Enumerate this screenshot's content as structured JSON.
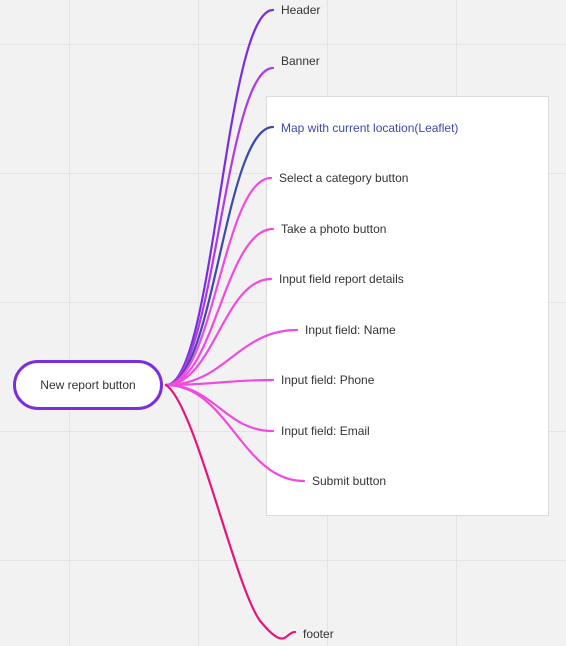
{
  "diagram": {
    "root": {
      "label": "New report button",
      "color": "#7b2ee0"
    },
    "children": [
      {
        "label": "Header",
        "color": "#7b2ee0"
      },
      {
        "label": "Banner",
        "color": "#b03ae8"
      },
      {
        "label": "Map with current location(Leaflet)",
        "color": "#3d4aa8"
      },
      {
        "label": "Select a category button",
        "color": "#f04be0"
      },
      {
        "label": "Take a photo button",
        "color": "#f04be0"
      },
      {
        "label": "Input field report details",
        "color": "#f04be0"
      },
      {
        "label": "Input field: Name",
        "color": "#f04be0"
      },
      {
        "label": "Input field: Phone",
        "color": "#f04be0"
      },
      {
        "label": "Input field: Email",
        "color": "#f04be0"
      },
      {
        "label": "Submit button",
        "color": "#f04be0"
      },
      {
        "label": "footer",
        "color": "#e8137a"
      }
    ]
  }
}
